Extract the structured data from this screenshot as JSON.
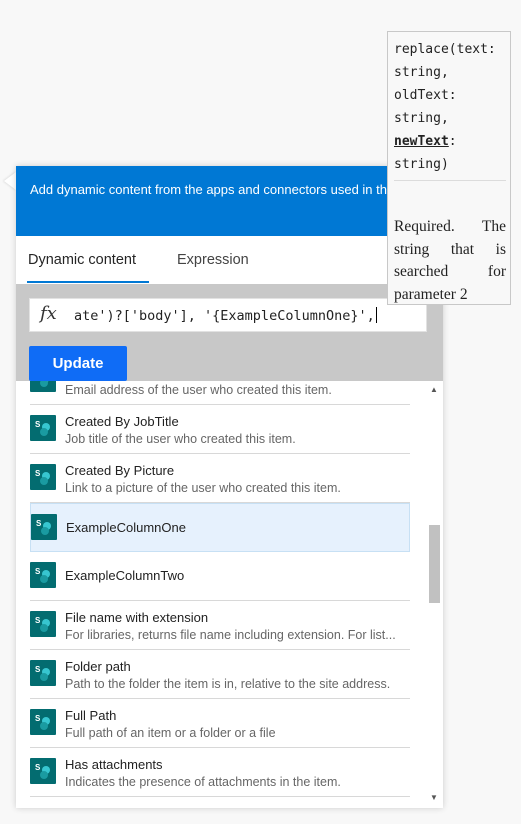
{
  "header": {
    "text": "Add dynamic content from the apps and connectors used in this flow."
  },
  "tabs": {
    "dynamic": "Dynamic content",
    "expression": "Expression"
  },
  "formula": {
    "icon": "fx",
    "value": "ate')?['body'], '{ExampleColumnOne}',"
  },
  "update_button": "Update",
  "list": {
    "items": [
      {
        "title": "",
        "desc": "Email address of the user who created this item."
      },
      {
        "title": "Created By JobTitle",
        "desc": "Job title of the user who created this item."
      },
      {
        "title": "Created By Picture",
        "desc": "Link to a picture of the user who created this item."
      },
      {
        "title": "ExampleColumnOne",
        "desc": ""
      },
      {
        "title": "ExampleColumnTwo",
        "desc": ""
      },
      {
        "title": "File name with extension",
        "desc": "For libraries, returns file name including extension. For list..."
      },
      {
        "title": "Folder path",
        "desc": "Path to the folder the item is in, relative to the site address."
      },
      {
        "title": "Full Path",
        "desc": "Full path of an item or a folder or a file"
      },
      {
        "title": "Has attachments",
        "desc": "Indicates the presence of attachments in the item."
      }
    ],
    "icon": "sharepoint-icon",
    "icon_color": "#036c70"
  },
  "tooltip": {
    "sig_l1": "replace(text:",
    "sig_l2": "string,",
    "sig_l3": "oldText:",
    "sig_l4": "string,",
    "sig_active": "newText",
    "sig_colon": ":",
    "sig_l6": "string)",
    "description": "Required. The string that is searched for parameter 2"
  },
  "colors": {
    "accent": "#0078d4",
    "button": "#0f6cf6",
    "selected": "#e6f1fd"
  }
}
